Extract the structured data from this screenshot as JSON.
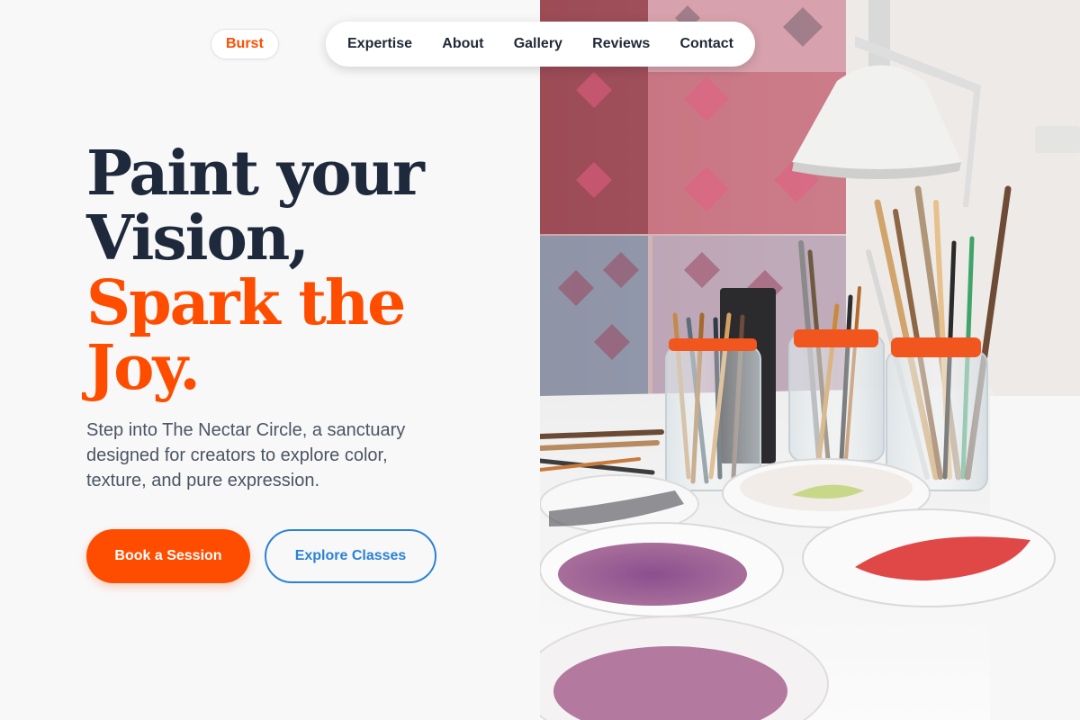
{
  "brand": {
    "logo_text": "Burst",
    "accent_color": "#ff4d00",
    "link_color": "#2a82d6"
  },
  "nav": {
    "items": [
      {
        "label": "Expertise"
      },
      {
        "label": "About"
      },
      {
        "label": "Gallery"
      },
      {
        "label": "Reviews"
      },
      {
        "label": "Contact"
      }
    ]
  },
  "hero": {
    "title_line1": "Paint your",
    "title_line2": "Vision,",
    "title_line3": "Spark the",
    "title_line4": "Joy.",
    "subtitle": "Step into The Nectar Circle, a sanctuary designed for creators to explore color, texture, and pure expression.",
    "primary_button": "Book a Session",
    "secondary_button": "Explore Classes"
  },
  "image": {
    "subject": "art-studio-photo"
  }
}
